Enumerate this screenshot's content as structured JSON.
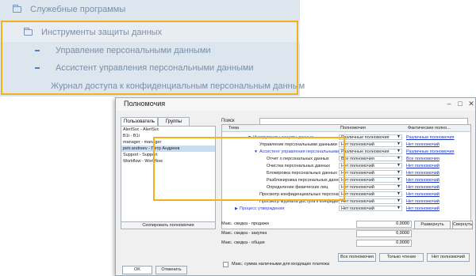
{
  "menu": {
    "utilities": "Служебные программы",
    "tools": "Инструменты защиты данных",
    "sub": [
      "Управление персональными данными",
      "Ассистент управления персональными данными",
      "Журнал доступа к конфиденциальным персональным данным"
    ]
  },
  "dialog": {
    "title": "Полномочия",
    "tabs": {
      "users": "Пользователь",
      "groups": "Группы"
    },
    "users": [
      "AlertSvc - AlertSvc",
      "B1i - B1i",
      "manager - manager",
      "petr.andreev - Петр Андреев",
      "Support - Support",
      "Workflow - Workflow"
    ],
    "copy_button": "Скопировать полномочия",
    "search_label": "Поиск",
    "grid_headers": {
      "theme": "Тема",
      "permission": "Полномочия",
      "actual": "Фактические полно..."
    },
    "grid_rows": [
      {
        "name": "Инструменты защиты данных",
        "permission": "Различные полномочия",
        "actual": "Различные полномочия"
      },
      {
        "name": "Управление персональными данными",
        "permission": "Нет полномочий",
        "actual": "Нет полномочий"
      },
      {
        "name": "Ассистент управления персональными данными",
        "permission": "Различные полномочия",
        "actual": "Различные полномочия"
      },
      {
        "name": "Отчет о персональных данных",
        "permission": "Все полномочия",
        "actual": "Все полномочия"
      },
      {
        "name": "Очистка персональных данных",
        "permission": "Нет полномочий",
        "actual": "Нет полномочий"
      },
      {
        "name": "Блокировка персональных данных",
        "permission": "Нет полномочий",
        "actual": "Нет полномочий"
      },
      {
        "name": "Разблокировка персональных данных",
        "permission": "Нет полномочий",
        "actual": "Нет полномочий"
      },
      {
        "name": "Определение физических лиц",
        "permission": "Нет полномочий",
        "actual": "Нет полномочий"
      },
      {
        "name": "Просмотр конфиденциальных персональных...",
        "permission": "Нет полномочий",
        "actual": "Нет полномочий"
      },
      {
        "name": "Просмотр журнала доступа к конфиденциальным...",
        "permission": "Нет полномочий",
        "actual": "Нет полномочий"
      },
      {
        "name": "Процесс утверждения",
        "permission": "Нет полномочий",
        "actual": "Нет полномочий"
      }
    ],
    "fields": [
      {
        "label": "Макс. скидка - продажи",
        "value": "0,0000"
      },
      {
        "label": "Макс. скидка - закупка",
        "value": "0,0000"
      },
      {
        "label": "Макс. скидка - общая",
        "value": "0,0000"
      }
    ],
    "checkbox_label": "Макс. сумма наличными для входящих платежа",
    "buttons": {
      "expand": "Развернуть",
      "collapse": "Свернуть",
      "all": "Все полномочия",
      "readonly": "Только чтение",
      "none": "Нет полномочий",
      "ok": "OK",
      "cancel": "Отменить"
    }
  }
}
